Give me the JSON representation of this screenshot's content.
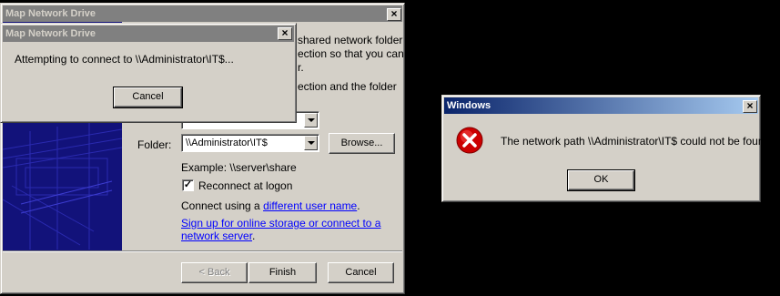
{
  "map_dialog": {
    "title": "Map Network Drive",
    "desc_line1": "shared network folder",
    "desc_line2": "ection so that you can",
    "desc_line3": "r.",
    "desc_line4": "ection and the folder",
    "folder_label": "Folder:",
    "folder_value": "\\\\Administrator\\IT$",
    "browse_label": "Browse...",
    "example_text": "Example: \\\\server\\share",
    "reconnect_label": "Reconnect at logon",
    "reconnect_checked": true,
    "connect_using_prefix": "Connect using a ",
    "different_user_link": "different user name",
    "connect_using_suffix": ".",
    "signup_link_line1": "Sign up for online storage or connect to a",
    "signup_link_line2": "network server",
    "signup_suffix": ".",
    "back_label": "< Back",
    "finish_label": "Finish",
    "cancel_label": "Cancel"
  },
  "progress_dialog": {
    "title": "Map Network Drive",
    "message": "Attempting to connect to \\\\Administrator\\IT$...",
    "cancel_label": "Cancel"
  },
  "error_dialog": {
    "title": "Windows",
    "icon": "error-icon",
    "message": "The network path \\\\Administrator\\IT$ could not be found.",
    "ok_label": "OK"
  },
  "colors": {
    "desktop": "#000000",
    "dialog_face": "#d4d0c8",
    "wizard_banner": "#12127a",
    "active_title_start": "#0a246a",
    "active_title_end": "#a6caf0",
    "error_icon": "#cc0000"
  }
}
